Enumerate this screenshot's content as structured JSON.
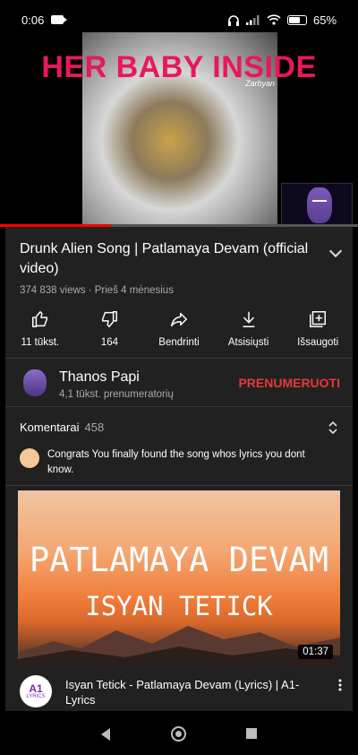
{
  "status": {
    "time": "0:06",
    "battery": "65",
    "battery_level": 0.65
  },
  "video": {
    "overlay_title": "HER BABY INSIDE",
    "watermark": "Zarbyan",
    "progress": 0.31
  },
  "info": {
    "title": "Drunk Alien Song | Patlamaya Devam (official video)",
    "meta": "374 838 views · Prieš 4 mėnesius"
  },
  "actions": [
    {
      "label": "11 tūkst.",
      "icon": "thumbs-up-icon"
    },
    {
      "label": "164",
      "icon": "thumbs-down-icon"
    },
    {
      "label": "Bendrinti",
      "icon": "share-icon"
    },
    {
      "label": "Atsisiųsti",
      "icon": "download-icon"
    },
    {
      "label": "Išsaugoti",
      "icon": "add-to-playlist-icon"
    }
  ],
  "channel": {
    "name": "Thanos Papi",
    "subscribers": "4,1 tūkst. prenumeratorių",
    "subscribe_label": "PRENUMERUOTI",
    "subscribe_color": "#e53935"
  },
  "comments": {
    "label": "Komentarai",
    "count": "458",
    "top_comment": "Congrats You finally found the song whos lyrics you dont know."
  },
  "next_video": {
    "thumb_line1": "PATLAMAYA DEVAM",
    "thumb_line2": "ISYAN TETICK",
    "duration": "01:37",
    "title": "Isyan Tetick - Patlamaya Devam (Lyrics) | A1-Lyrics",
    "channel_logo_text": "A1",
    "channel_logo_sub": "LYRICS"
  },
  "colors": {
    "accent_red": "#ff0000",
    "overlay_pink": "#e8185a"
  }
}
